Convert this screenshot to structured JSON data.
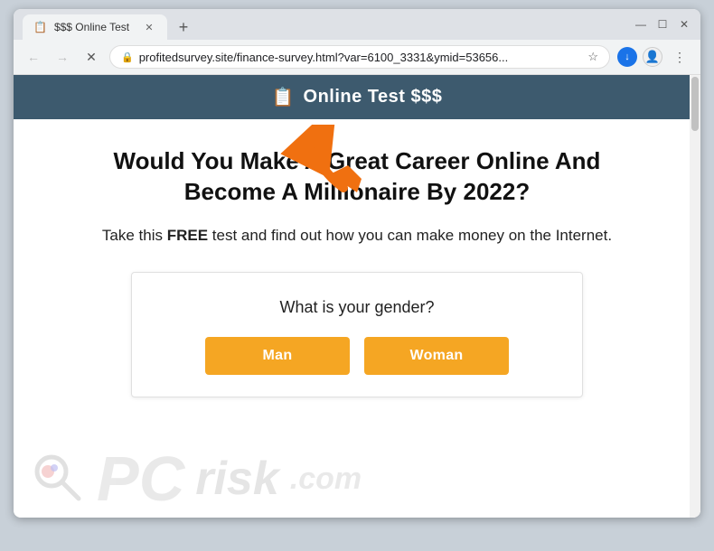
{
  "browser": {
    "tab_favicon": "📋",
    "tab_title": "$$$ Online Test",
    "new_tab_icon": "+",
    "back_icon": "←",
    "forward_icon": "→",
    "close_icon": "✕",
    "refresh_icon": "✕",
    "url": "profitedsurvey.site/finance-survey.html?var=6100_3331&ymid=53656...",
    "bookmark_icon": "☆",
    "download_icon": "↓",
    "profile_icon": "👤",
    "menu_icon": "⋮",
    "minimize_icon": "—",
    "maximize_icon": "☐",
    "winclose_icon": "✕"
  },
  "site": {
    "header_icon": "📋",
    "header_title": "Online Test $$$"
  },
  "page": {
    "headline": "Would You Make A Great Career Online And Become A Millionaire By 2022?",
    "subtext_plain": "Take this ",
    "subtext_bold": "FREE",
    "subtext_rest": " test and find out how you can make money on the Internet.",
    "survey": {
      "question": "What is your gender?",
      "btn_man": "Man",
      "btn_woman": "Woman"
    }
  },
  "watermark": {
    "pc": "PC",
    "risk": "risk",
    "com": ".com"
  },
  "colors": {
    "orange_btn": "#f5a623",
    "header_bg": "#3d5a6e",
    "arrow_color": "#f07010"
  }
}
